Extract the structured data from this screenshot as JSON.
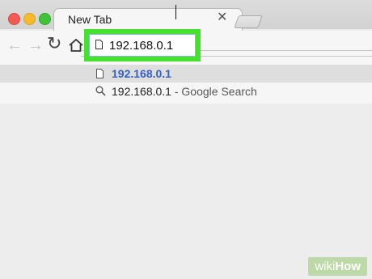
{
  "tab": {
    "title": "New Tab",
    "close": "✕"
  },
  "toolbar": {
    "back": "←",
    "forward": "→",
    "reload": "↻"
  },
  "omnibox": {
    "value": "192.168.0.1"
  },
  "suggestions": [
    {
      "icon": "page-icon",
      "text": "192.168.0.1",
      "suffix": ""
    },
    {
      "icon": "search-icon",
      "text": "192.168.0.1",
      "suffix": " - Google Search"
    }
  ],
  "watermark": {
    "prefix": "wiki",
    "bold": "How"
  },
  "colors": {
    "highlight": "#44e22c",
    "link": "#3661bf"
  }
}
